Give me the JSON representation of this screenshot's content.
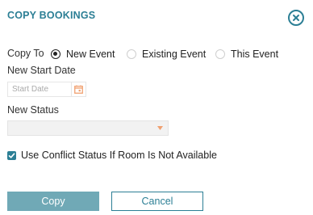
{
  "dialog": {
    "title": "COPY BOOKINGS",
    "accent_color": "#2c7f95"
  },
  "copy_to": {
    "label": "Copy To",
    "options": [
      {
        "label": "New Event",
        "selected": true
      },
      {
        "label": "Existing Event",
        "selected": false
      },
      {
        "label": "This Event",
        "selected": false
      }
    ]
  },
  "start_date": {
    "label": "New Start Date",
    "placeholder": "Start Date",
    "value": "",
    "icon": "calendar-icon",
    "icon_color": "#f0a070"
  },
  "status": {
    "label": "New Status",
    "value": "",
    "caret_color": "#f0a070"
  },
  "conflict_checkbox": {
    "label": "Use Conflict Status If Room Is Not Available",
    "checked": true
  },
  "buttons": {
    "copy_label": "Copy",
    "cancel_label": "Cancel"
  }
}
